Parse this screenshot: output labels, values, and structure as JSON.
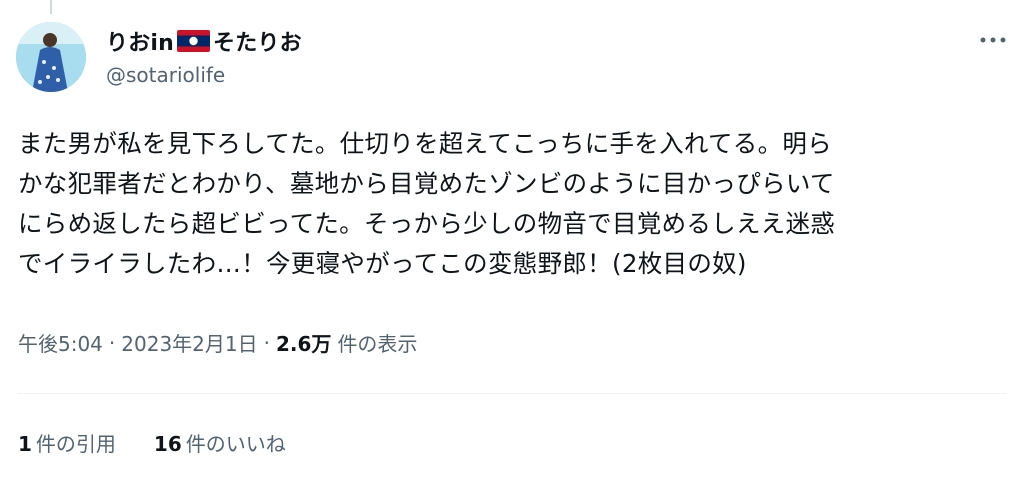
{
  "author": {
    "name_prefix": "りおin",
    "name_suffix": "そたりお",
    "handle": "@sotariolife",
    "flag_icon": "laos-flag-icon"
  },
  "tweet": {
    "text": "また男が私を見下ろしてた。仕切りを超えてこっちに手を入れてる。明ら\nかな犯罪者だとわかり、墓地から目覚めたゾンビのように目かっぴらいて\nにらめ返したら超ビビってた。そっから少しの物音で目覚めるしええ迷惑\nでイライラしたわ…！今更寝やがってこの変態野郎！(2枚目の奴)"
  },
  "meta": {
    "time": "午後5:04",
    "date": "2023年2月1日",
    "views_count": "2.6万",
    "views_label": "件の表示",
    "separator": "·"
  },
  "stats": {
    "quotes_count": "1",
    "quotes_label": "件の引用",
    "likes_count": "16",
    "likes_label": "件のいいね"
  },
  "colors": {
    "text_primary": "#0f1419",
    "text_secondary": "#536471",
    "divider": "#eff3f4",
    "flag_red": "#ce1126",
    "flag_blue": "#002868"
  }
}
